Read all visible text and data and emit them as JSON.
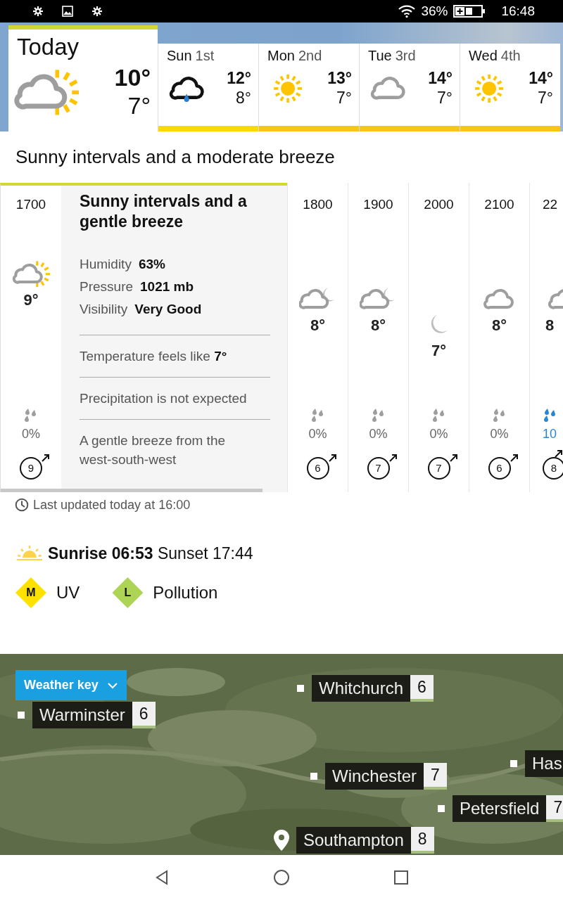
{
  "status_bar": {
    "battery": "36%",
    "time": "16:48"
  },
  "days": [
    {
      "day": "Today",
      "kind": "sun-cloud",
      "high": "10°",
      "low": "7°",
      "selected": true
    },
    {
      "day": "Sun",
      "date": "1st",
      "kind": "rain-cloud",
      "high": "12°",
      "low": "8°",
      "selected": false,
      "color": "#ffd800"
    },
    {
      "day": "Mon",
      "date": "2nd",
      "kind": "sun",
      "high": "13°",
      "low": "7°",
      "selected": false,
      "color": "#fcc419"
    },
    {
      "day": "Tue",
      "date": "3rd",
      "kind": "cloud",
      "high": "14°",
      "low": "7°",
      "selected": false,
      "color": "#fcc419"
    },
    {
      "day": "Wed",
      "date": "4th",
      "kind": "sun",
      "high": "14°",
      "low": "7°",
      "selected": false,
      "color": "#fcc419"
    }
  ],
  "summary": "Sunny intervals and a moderate breeze",
  "hours": [
    {
      "time": "1700",
      "kind": "sun-cloud",
      "temp": "9°",
      "precip": "0%",
      "wind": "9",
      "selected": true
    },
    {
      "time": "1800",
      "kind": "cloud-moon",
      "temp": "8°",
      "precip": "0%",
      "wind": "6",
      "selected": false
    },
    {
      "time": "1900",
      "kind": "cloud-moon",
      "temp": "8°",
      "precip": "0%",
      "wind": "7",
      "selected": false
    },
    {
      "time": "2000",
      "kind": "moon",
      "temp": "7°",
      "precip": "0%",
      "wind": "7",
      "selected": false
    },
    {
      "time": "2100",
      "kind": "cloud",
      "temp": "8°",
      "precip": "0%",
      "wind": "6",
      "selected": false
    },
    {
      "time": "22",
      "kind": "cloud",
      "temp": "8",
      "precip": "10",
      "wind": "8",
      "selected": false
    }
  ],
  "detail": {
    "title": "Sunny intervals and a gentle breeze",
    "stats": [
      {
        "label": "Humidity",
        "value": "63%"
      },
      {
        "label": "Pressure",
        "value": "1021 mb"
      },
      {
        "label": "Visibility",
        "value": "Very Good"
      }
    ],
    "notes": [
      "Temperature feels like **7°**",
      "Precipitation is not expected",
      "A gentle breeze from the west-south-west"
    ]
  },
  "last_updated": "Last updated today at 16:00",
  "sun_times": "**Sunrise 06:53** Sunset 17:44",
  "indices": [
    {
      "badge": "M",
      "label": "UV",
      "color": "#ffe100"
    },
    {
      "badge": "L",
      "label": "Pollution",
      "color": "#aed456"
    }
  ],
  "map": {
    "kind": "picture",
    "key_button": "Weather key",
    "places": [
      {
        "name": "Warminster",
        "temp": "6",
        "kind": "marker"
      },
      {
        "name": "Whitchurch",
        "temp": "6",
        "kind": "marker"
      },
      {
        "name": "Winchester",
        "temp": "7",
        "kind": "marker"
      },
      {
        "name": "Has",
        "kind": "marker"
      },
      {
        "name": "Petersfield",
        "temp": "7",
        "kind": "marker"
      },
      {
        "name": "Southampton",
        "temp": "8",
        "kind": "pin"
      }
    ]
  }
}
